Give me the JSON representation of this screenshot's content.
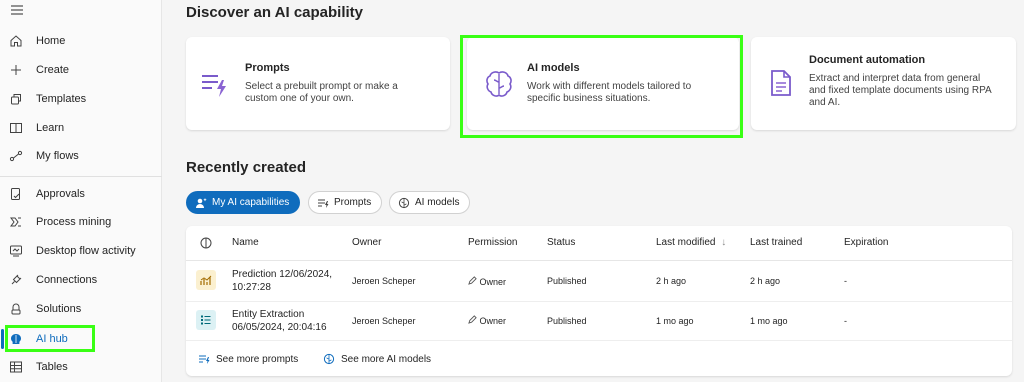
{
  "sidebar": {
    "items": [
      {
        "label": "Home",
        "icon": "home-icon"
      },
      {
        "label": "Create",
        "icon": "plus-icon"
      },
      {
        "label": "Templates",
        "icon": "templates-icon"
      },
      {
        "label": "Learn",
        "icon": "book-icon"
      },
      {
        "label": "My flows",
        "icon": "flows-icon"
      },
      {
        "label": "Approvals",
        "icon": "approvals-icon"
      },
      {
        "label": "Process mining",
        "icon": "process-mining-icon"
      },
      {
        "label": "Desktop flow activity",
        "icon": "desktop-flow-icon"
      },
      {
        "label": "Connections",
        "icon": "plug-icon"
      },
      {
        "label": "Solutions",
        "icon": "solutions-icon"
      },
      {
        "label": "AI hub",
        "icon": "brain-icon",
        "active": true
      },
      {
        "label": "Tables",
        "icon": "table-icon"
      }
    ]
  },
  "discover": {
    "heading": "Discover an AI capability",
    "cards": [
      {
        "title": "Prompts",
        "desc": [
          "Select a prebuilt prompt or make a",
          "custom one of your own."
        ]
      },
      {
        "title": "AI models",
        "desc": [
          "Work with different models tailored to",
          "specific business situations."
        ]
      },
      {
        "title": "Document automation",
        "desc": [
          "Extract and interpret data from general",
          "and fixed template documents using RPA",
          "and AI."
        ]
      }
    ]
  },
  "recent": {
    "heading": "Recently created",
    "filters": [
      "My AI capabilities",
      "Prompts",
      "AI models"
    ],
    "columns": [
      "Name",
      "Owner",
      "Permission",
      "Status",
      "Last modified",
      "Last trained",
      "Expiration"
    ],
    "sort_glyph": "↓",
    "rows": [
      {
        "name": [
          "Prediction 12/06/2024,",
          "10:27:28"
        ],
        "owner": "Jeroen Scheper",
        "permission": "Owner",
        "status": "Published",
        "modified": "2 h ago",
        "trained": "2 h ago",
        "expiration": "-"
      },
      {
        "name": [
          "Entity Extraction",
          "06/05/2024, 20:04:16"
        ],
        "owner": "Jeroen Scheper",
        "permission": "Owner",
        "status": "Published",
        "modified": "1 mo ago",
        "trained": "1 mo ago",
        "expiration": "-"
      }
    ],
    "footer_links": [
      "See more prompts",
      "See more AI models"
    ]
  },
  "colors": {
    "accent": "#0f6cbd",
    "highlight": "#39ff14"
  }
}
